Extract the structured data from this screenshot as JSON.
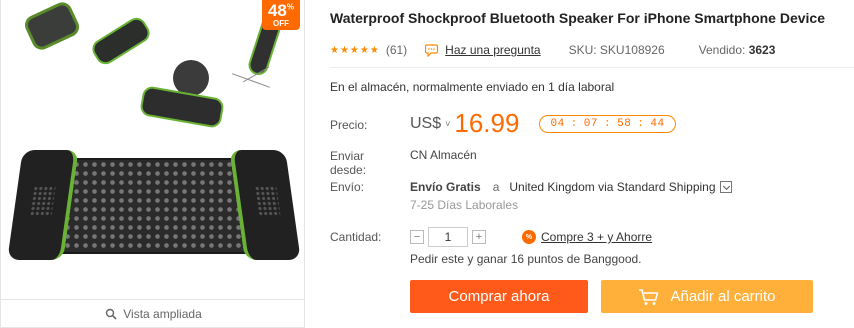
{
  "gallery": {
    "discount_value": "48",
    "discount_symbol": "%",
    "discount_off": "OFF",
    "zoom_label": "Vista ampliada"
  },
  "product": {
    "title": "Waterproof Shockproof Bluetooth Speaker For iPhone Smartphone Device",
    "rating_stars": "★★★★★",
    "rating_value": 5,
    "reviews_count": "(61)",
    "ask_question": "Haz una pregunta",
    "sku": "SKU: SKU108926",
    "sold_label": "Vendido:",
    "sold_value": "3623",
    "stock_text": "En el almacén, normalmente enviado en 1 día laboral"
  },
  "price": {
    "label": "Precio:",
    "currency": "US$",
    "caret": "˅",
    "value": "16.99",
    "countdown": [
      "04",
      "07",
      "58",
      "44"
    ],
    "countdown_sep": ":"
  },
  "shipping": {
    "from_label_line1": "Enviar",
    "from_label_line2": "desde:",
    "from_value": "CN Almacén",
    "label": "Envío:",
    "free": "Envío Gratis",
    "to_word": "a",
    "destination": "United Kingdom via Standard Shipping",
    "days": "7-25 Días Laborales"
  },
  "quantity": {
    "label": "Cantidad:",
    "minus": "−",
    "plus": "+",
    "value": "1",
    "promo_icon": "%",
    "promo_text": "Compre 3 + y Ahorre"
  },
  "points_text": "Pedir este y ganar 16 puntos de Banggood.",
  "actions": {
    "buy_now": "Comprar ahora",
    "add_to_cart": "Añadir al carrito"
  },
  "colors": {
    "accent": "#ff6a00",
    "buy": "#ff5a1a",
    "cart": "#ffb03a",
    "product_green": "#69b236"
  }
}
